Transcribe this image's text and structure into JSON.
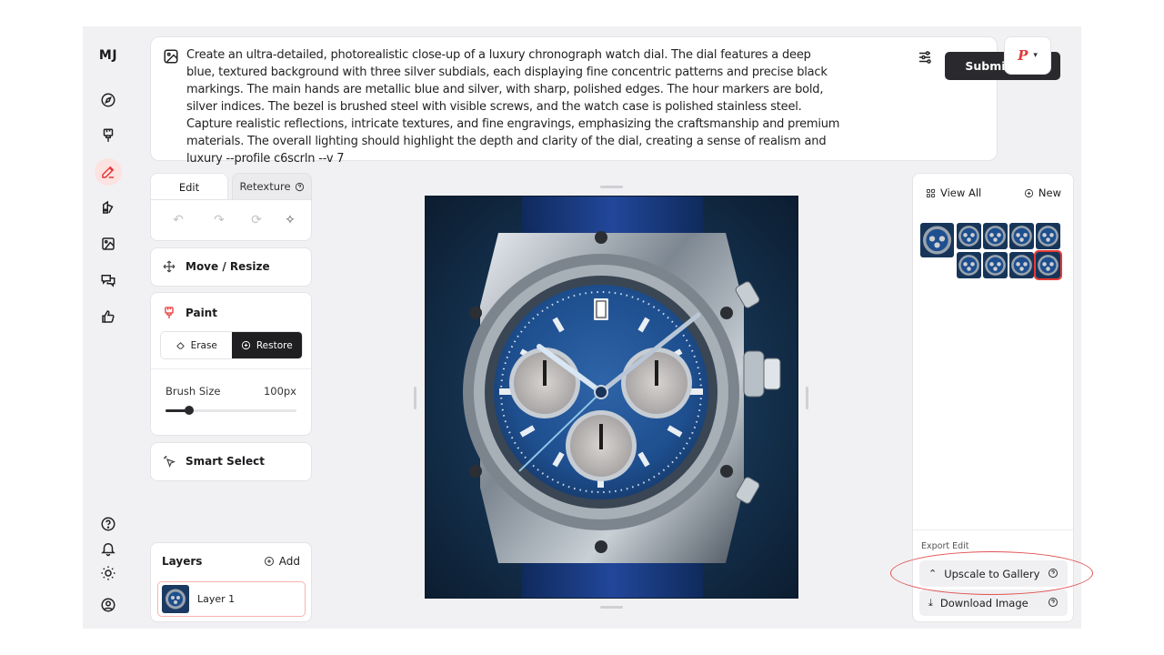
{
  "brand": "MJ",
  "nav": [
    {
      "id": "explore",
      "icon": "compass-icon"
    },
    {
      "id": "create",
      "icon": "paintbrush-icon"
    },
    {
      "id": "edit",
      "icon": "edit-pencil-icon",
      "active": true
    },
    {
      "id": "personalize",
      "icon": "palette-icon"
    },
    {
      "id": "organize",
      "icon": "image-icon"
    },
    {
      "id": "chat",
      "icon": "chat-bubbles-icon"
    },
    {
      "id": "tasks",
      "icon": "thumbs-up-icon"
    },
    {
      "id": "help",
      "icon": "help-circle-icon"
    },
    {
      "id": "updates",
      "icon": "bell-icon"
    },
    {
      "id": "theme",
      "icon": "sun-icon"
    },
    {
      "id": "account",
      "icon": "user-circle-icon"
    }
  ],
  "prompt": {
    "text": "Create an ultra-detailed, photorealistic close-up of a luxury chronograph watch dial. The dial features a deep blue, textured background with three silver subdials, each displaying fine concentric patterns and precise black markings. The main hands are metallic blue and silver, with sharp, polished edges. The hour markers are bold, silver indices. The bezel is brushed steel with visible screws, and the watch case is polished stainless steel. Capture realistic reflections, intricate textures, and fine engravings, emphasizing the craftsmanship and premium materials. The overall lighting should highlight the depth and clarity of the dial, creating a sense of realism and luxury --profile c6scrln --v 7",
    "submit_label": "Submit Edit",
    "profile_letter": "P"
  },
  "tabs": {
    "edit": "Edit",
    "retexture": "Retexture"
  },
  "tools": {
    "move": "Move / Resize",
    "paint": "Paint",
    "erase": "Erase",
    "restore": "Restore",
    "brush_label": "Brush Size",
    "brush_value": "100px",
    "brush_fraction": 0.18,
    "smart_select": "Smart Select"
  },
  "layers": {
    "title": "Layers",
    "add": "Add",
    "items": [
      {
        "label": "Layer 1"
      }
    ]
  },
  "gallery": {
    "view_all": "View All",
    "new": "New",
    "selected_index": 8
  },
  "export": {
    "label": "Export Edit",
    "upscale": "Upscale to Gallery",
    "download": "Download Image"
  },
  "colors": {
    "accent": "#e53935",
    "dark": "#2a2a2e",
    "dial_blue": "#1e4f8f"
  }
}
